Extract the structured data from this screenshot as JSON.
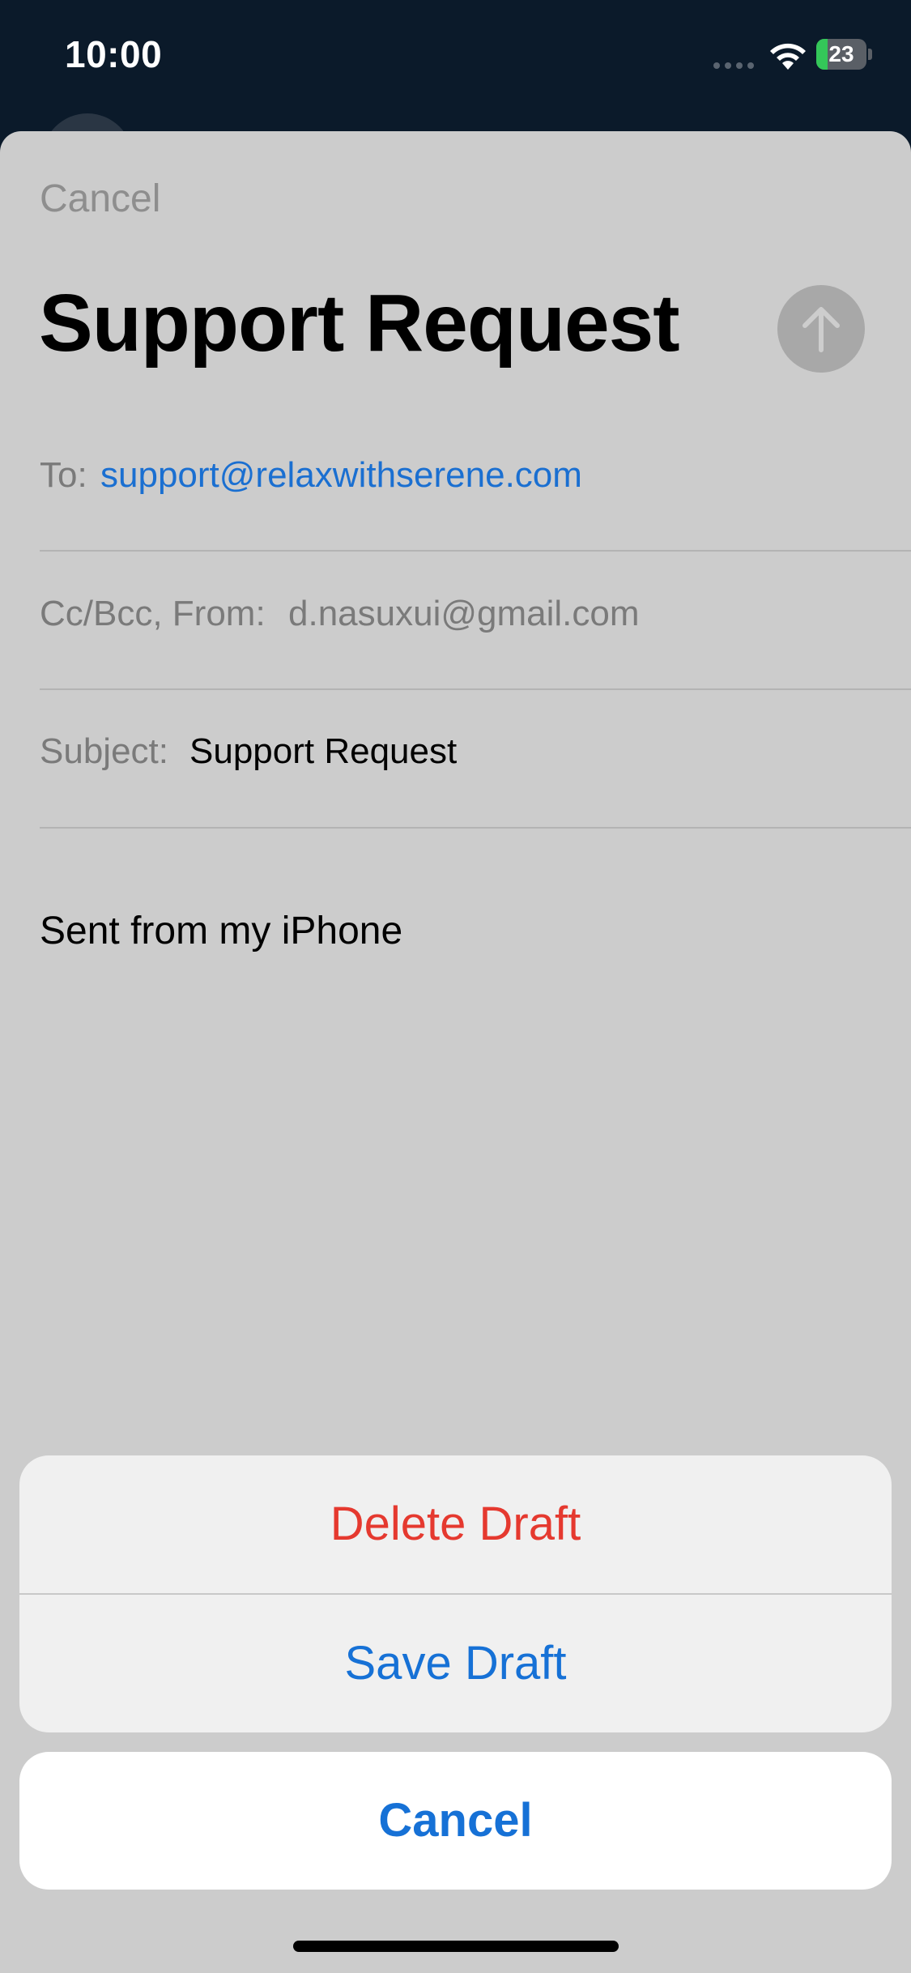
{
  "status_bar": {
    "time": "10:00",
    "battery_level": "23",
    "battery_fraction": 0.23
  },
  "compose": {
    "cancel_label": "Cancel",
    "title": "Support Request",
    "send_icon": "arrow-up-icon",
    "to_label": "To:",
    "to_value": "support@relaxwithserene.com",
    "ccbcc_label": "Cc/Bcc, From:",
    "from_value": "d.nasuxui@gmail.com",
    "subject_label": "Subject:",
    "subject_value": "Support Request",
    "body": "Sent from my iPhone"
  },
  "action_sheet": {
    "delete_label": "Delete Draft",
    "save_label": "Save Draft",
    "cancel_label": "Cancel"
  },
  "colors": {
    "destructive": "#e5392f",
    "accent": "#1671d6",
    "link": "#1a6fd1",
    "battery_green": "#34c759"
  }
}
